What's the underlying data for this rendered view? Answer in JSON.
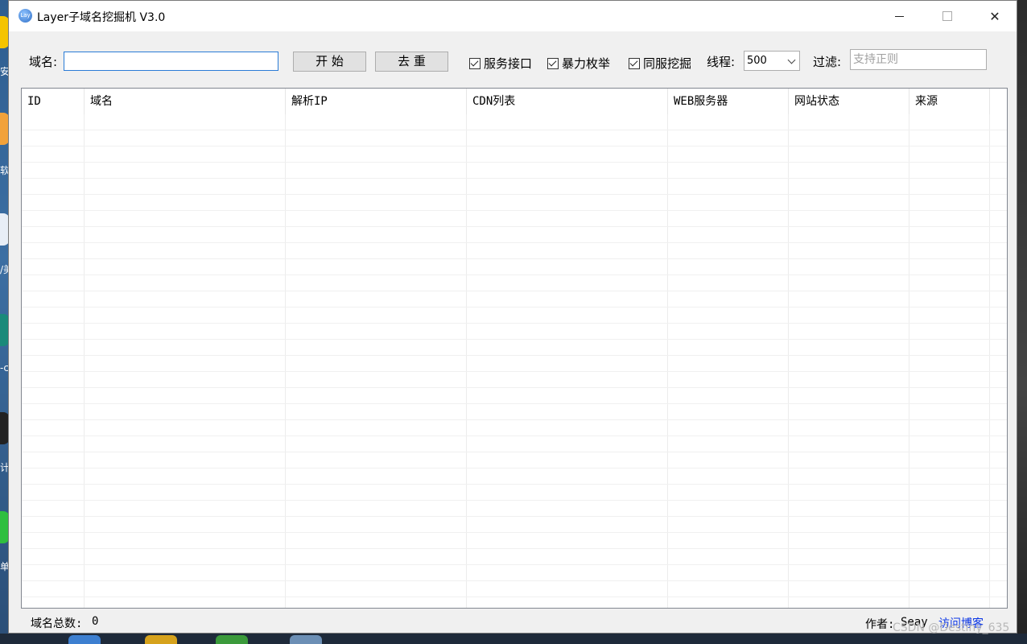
{
  "window": {
    "title": "Layer子域名挖掘机 V3.0",
    "app_icon_text": "Lay",
    "close_glyph": "✕"
  },
  "toolbar": {
    "domain_label": "域名:",
    "domain_value": "",
    "start_button": "开 始",
    "dedupe_button": "去 重",
    "checkboxes": [
      {
        "label": "服务接口",
        "checked": true
      },
      {
        "label": "暴力枚举",
        "checked": true
      },
      {
        "label": "同服挖掘",
        "checked": true
      }
    ],
    "threads_label": "线程:",
    "threads_value": "500",
    "filter_label": "过滤:",
    "filter_placeholder": "支持正则"
  },
  "table": {
    "columns": [
      "ID",
      "域名",
      "解析IP",
      "CDN列表",
      "WEB服务器",
      "网站状态",
      "来源"
    ],
    "rows": []
  },
  "status": {
    "total_label": "域名总数:",
    "total_count": "0",
    "author_label": "作者:",
    "author_name": "Seay",
    "blog_link": "访问博客"
  },
  "watermark": "CSDN @Destiny_635",
  "desktop_labels": [
    "安",
    "软",
    "/美",
    "-c",
    "计",
    "单"
  ]
}
